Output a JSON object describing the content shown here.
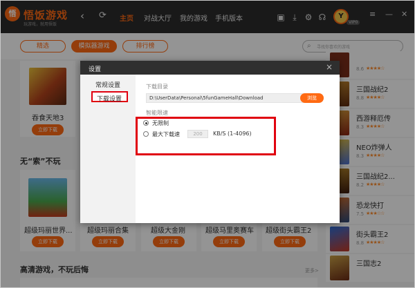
{
  "app": {
    "brand": "悟饭游戏",
    "brand_sub": "玩游戏，就用悟饭",
    "nav": [
      "主页",
      "对战大厅",
      "我的游戏",
      "手机版本"
    ],
    "vip": "VIP0"
  },
  "subtabs": [
    "精选",
    "模拟器游戏",
    "排行榜"
  ],
  "search_placeholder": "寻找你喜欢的游戏",
  "games": {
    "top": {
      "title": "吞食天地3",
      "button": "立即下载"
    },
    "section1": "无“索”不玩",
    "row": [
      {
        "title": "超级玛丽世界...",
        "button": "立即下载"
      },
      {
        "title": "超级玛丽合集",
        "button": "立即下载"
      },
      {
        "title": "超级大金刚",
        "button": "立即下载"
      },
      {
        "title": "超级马里奥赛车",
        "button": "立即下载"
      },
      {
        "title": "超级街头霸王2",
        "button": "立即下载"
      }
    ],
    "section2": "高清游戏，不玩后悔",
    "more": "更多>"
  },
  "ranking": [
    {
      "name": "",
      "score": "8.6"
    },
    {
      "name": "三国战纪2",
      "score": "8.8"
    },
    {
      "name": "西游释厄传",
      "score": "8.3"
    },
    {
      "name": "NEO炸弹人",
      "score": "8.3"
    },
    {
      "name": "三国战纪2...",
      "score": "8.2"
    },
    {
      "name": "恐龙快打",
      "score": "7.5"
    },
    {
      "name": "街头霸王2",
      "score": "8.8"
    },
    {
      "name": "三国志2",
      "score": ""
    }
  ],
  "dialog": {
    "title": "设置",
    "menu": [
      "常规设置",
      "下载设置"
    ],
    "dir_label": "下载目录",
    "dir_path": "D:\\UserData\\Personal\\5funGameHall\\Download",
    "browse": "浏览",
    "limit_label": "智能限速",
    "opt_unlimited": "无限制",
    "opt_max": "最大下载速",
    "speed_value": "200",
    "speed_unit": "KB/S (1-4096)"
  },
  "colors": {
    "accent": "#ff6a13",
    "highlight": "#e0000f",
    "titlebar": "#2b2b2b"
  }
}
